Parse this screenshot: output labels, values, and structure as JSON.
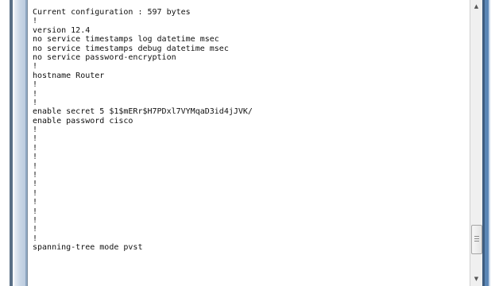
{
  "terminal": {
    "lines": [
      "Current configuration : 597 bytes",
      "!",
      "version 12.4",
      "no service timestamps log datetime msec",
      "no service timestamps debug datetime msec",
      "no service password-encryption",
      "!",
      "hostname Router",
      "!",
      "!",
      "!",
      "enable secret 5 $1$mERr$H7PDxl7VYMqaD3id4jJVK/",
      "enable password cisco",
      "!",
      "!",
      "!",
      "!",
      "!",
      "!",
      "!",
      "!",
      "!",
      "!",
      "!",
      "!",
      "!",
      "spanning-tree mode pvst"
    ]
  },
  "scrollbar": {
    "up_icon": "▲",
    "down_icon": "▼",
    "position_fraction": 0.82
  }
}
